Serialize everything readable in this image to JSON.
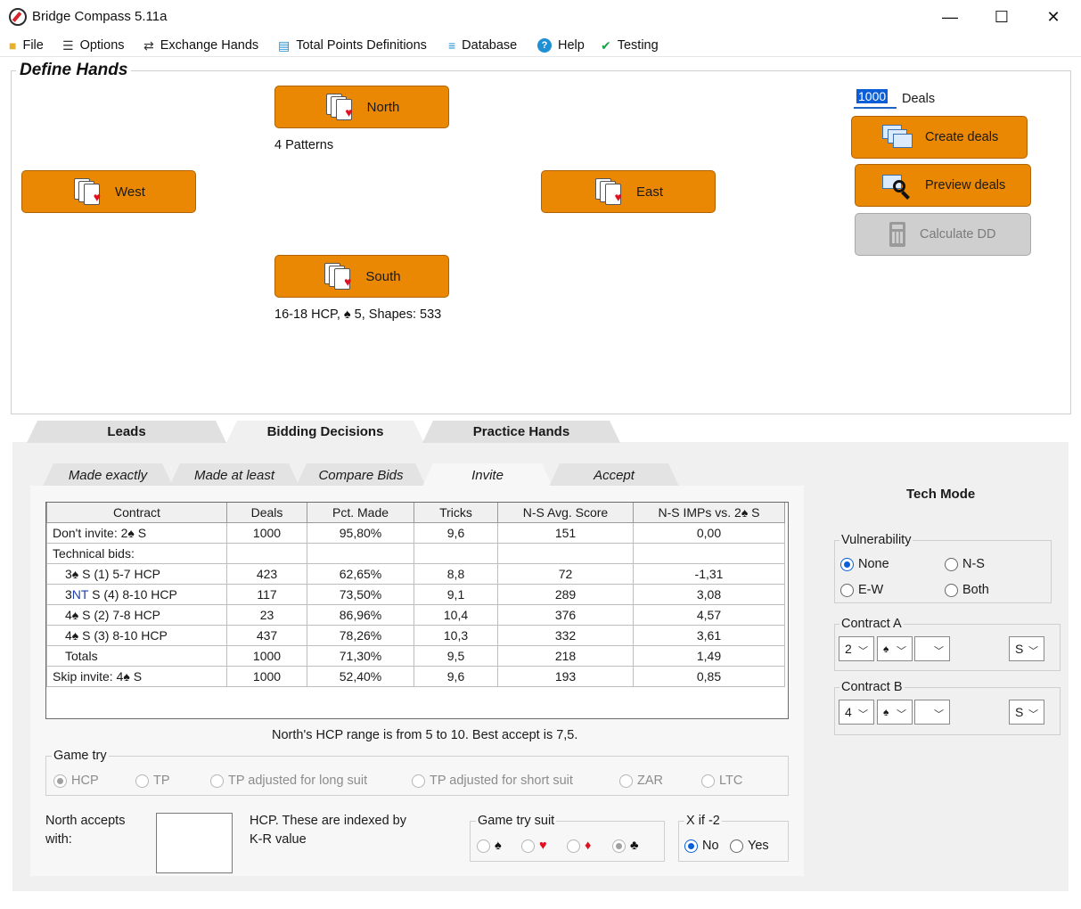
{
  "window": {
    "title": "Bridge Compass 5.11a",
    "minimize": "—",
    "maximize": "☐",
    "close": "✕"
  },
  "menu": [
    {
      "label": "File",
      "icon": "folder-icon"
    },
    {
      "label": "Options",
      "icon": "list-icon"
    },
    {
      "label": "Exchange Hands",
      "icon": "exchange-icon"
    },
    {
      "label": "Total Points Definitions",
      "icon": "document-icon"
    },
    {
      "label": "Database",
      "icon": "database-icon"
    },
    {
      "label": "Help",
      "icon": "help-icon"
    },
    {
      "label": "Testing",
      "icon": "checkmark-icon"
    }
  ],
  "define": {
    "title": "Define Hands",
    "north": {
      "label": "North",
      "info": "4 Patterns"
    },
    "west": {
      "label": "West"
    },
    "east": {
      "label": "East"
    },
    "south": {
      "label": "South",
      "info": "16-18 HCP, ♠ 5, Shapes: 533"
    },
    "deals_value": "1000",
    "deals_label": "Deals",
    "create_label": "Create deals",
    "preview_label": "Preview deals",
    "calc_label": "Calculate DD"
  },
  "main_tabs": [
    "Leads",
    "Bidding Decisions",
    "Practice Hands"
  ],
  "sub_tabs": [
    "Made exactly",
    "Made at least",
    "Compare Bids",
    "Invite",
    "Accept"
  ],
  "table": {
    "headers": [
      "Contract",
      "Deals",
      "Pct. Made",
      "Tricks",
      "N-S Avg. Score",
      "N-S IMPs vs. 2♠ S"
    ],
    "rows": [
      [
        "Don't invite: 2♠ S",
        "1000",
        "95,80%",
        "9,6",
        "151",
        "0,00"
      ],
      [
        "Technical bids:",
        "",
        "",
        "",
        "",
        ""
      ],
      [
        "3♠ S  (1) 5-7 HCP",
        "423",
        "62,65%",
        "8,8",
        "72",
        "-1,31"
      ],
      [
        "3NT S  (4) 8-10 HCP",
        "117",
        "73,50%",
        "9,1",
        "289",
        "3,08"
      ],
      [
        "4♠ S  (2) 7-8 HCP",
        "23",
        "86,96%",
        "10,4",
        "376",
        "4,57"
      ],
      [
        "4♠ S  (3) 8-10 HCP",
        "437",
        "78,26%",
        "10,3",
        "332",
        "3,61"
      ],
      [
        "Totals",
        "1000",
        "71,30%",
        "9,5",
        "218",
        "1,49"
      ],
      [
        "Skip invite: 4♠ S",
        "1000",
        "52,40%",
        "9,6",
        "193",
        "0,85"
      ]
    ]
  },
  "best_text": "North's HCP range is from 5 to 10. Best accept is 7,5.",
  "game_try": {
    "title": "Game try",
    "options": [
      "HCP",
      "TP",
      "TP adjusted for long suit",
      "TP adjusted for short suit",
      "ZAR",
      "LTC"
    ],
    "selected": "HCP"
  },
  "accept": {
    "label1": "North accepts",
    "label2": "with:",
    "note1": "HCP. These are indexed by",
    "note2": "K-R value"
  },
  "game_try_suit": {
    "title": "Game try suit",
    "suits": [
      "♠",
      "♥",
      "♦",
      "♣"
    ],
    "selected": "♣"
  },
  "x_if": {
    "title": "X if -2",
    "options": [
      "No",
      "Yes"
    ],
    "selected": "No"
  },
  "tech_mode": {
    "title": "Tech Mode",
    "vulnerability": {
      "title": "Vulnerability",
      "options": [
        "None",
        "N-S",
        "E-W",
        "Both"
      ],
      "selected": "None"
    },
    "contract_a": {
      "title": "Contract A",
      "level": "2",
      "suit": "♠",
      "extra": "",
      "declarer": "S"
    },
    "contract_b": {
      "title": "Contract B",
      "level": "4",
      "suit": "♠",
      "extra": "",
      "declarer": "S"
    }
  },
  "colors": {
    "orange": "#ea8703",
    "accent": "#0a5ed7",
    "heart": "#e01020"
  }
}
